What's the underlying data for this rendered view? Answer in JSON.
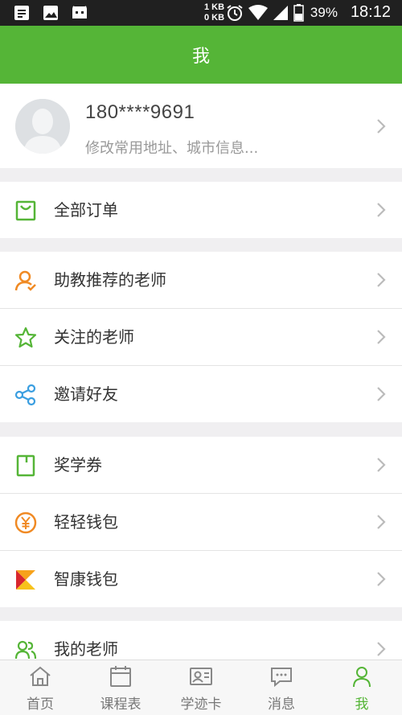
{
  "status_bar": {
    "net_up": "1 KB",
    "net_down": "0 KB",
    "battery": "39%",
    "time": "18:12"
  },
  "header": {
    "title": "我"
  },
  "profile": {
    "phone": "180****9691",
    "subtitle": "修改常用地址、城市信息..."
  },
  "menu": {
    "orders": "全部订单",
    "recommended_teachers": "助教推荐的老师",
    "followed_teachers": "关注的老师",
    "invite_friends": "邀请好友",
    "scholarship": "奖学券",
    "light_wallet": "轻轻钱包",
    "zhikang_wallet": "智康钱包",
    "my_teachers": "我的老师"
  },
  "tabs": [
    {
      "label": "首页",
      "icon": "home-icon"
    },
    {
      "label": "课程表",
      "icon": "calendar-icon"
    },
    {
      "label": "学迹卡",
      "icon": "id-card-icon"
    },
    {
      "label": "消息",
      "icon": "message-icon"
    },
    {
      "label": "我",
      "icon": "person-icon",
      "active": true
    }
  ],
  "colors": {
    "brand_green": "#55b537",
    "orange": "#f08a24",
    "status_bar": "#202020"
  }
}
